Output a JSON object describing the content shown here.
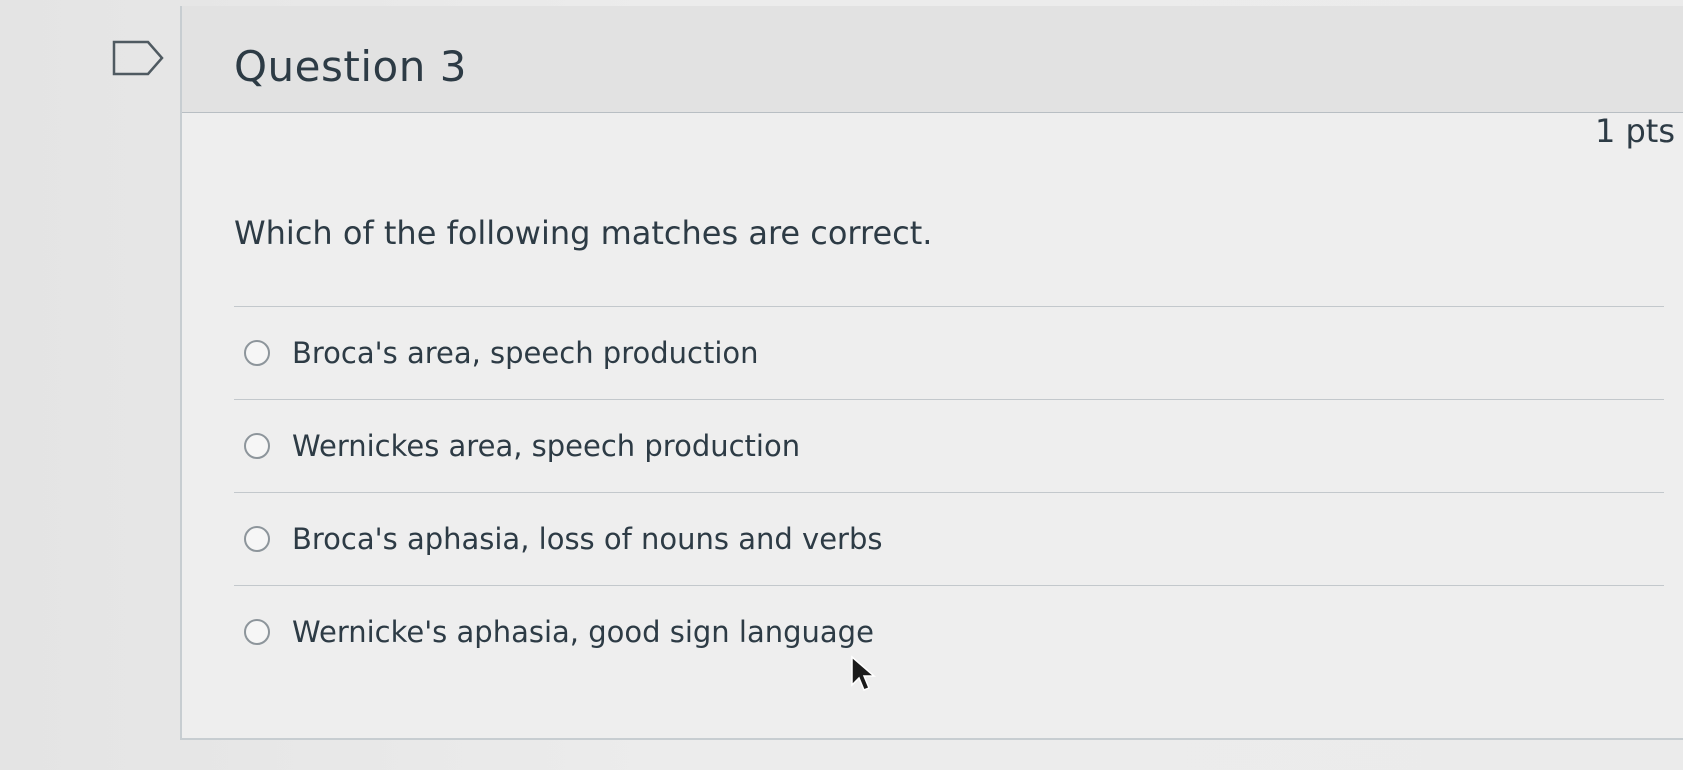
{
  "question": {
    "title": "Question 3",
    "points": "1 pts",
    "text": "Which of the following matches are correct.",
    "answers": [
      {
        "label": "Broca's area, speech production",
        "selected": false
      },
      {
        "label": "Wernickes area, speech production",
        "selected": false
      },
      {
        "label": "Broca's aphasia, loss of nouns and verbs",
        "selected": false
      },
      {
        "label": "Wernicke's aphasia, good sign language",
        "selected": false
      }
    ]
  },
  "icons": {
    "flag": "flag-icon",
    "cursor": "mouse-pointer-icon"
  },
  "colors": {
    "text": "#2d3b45",
    "border": "#c7cdd1",
    "header_bg": "#e2e2e2"
  }
}
